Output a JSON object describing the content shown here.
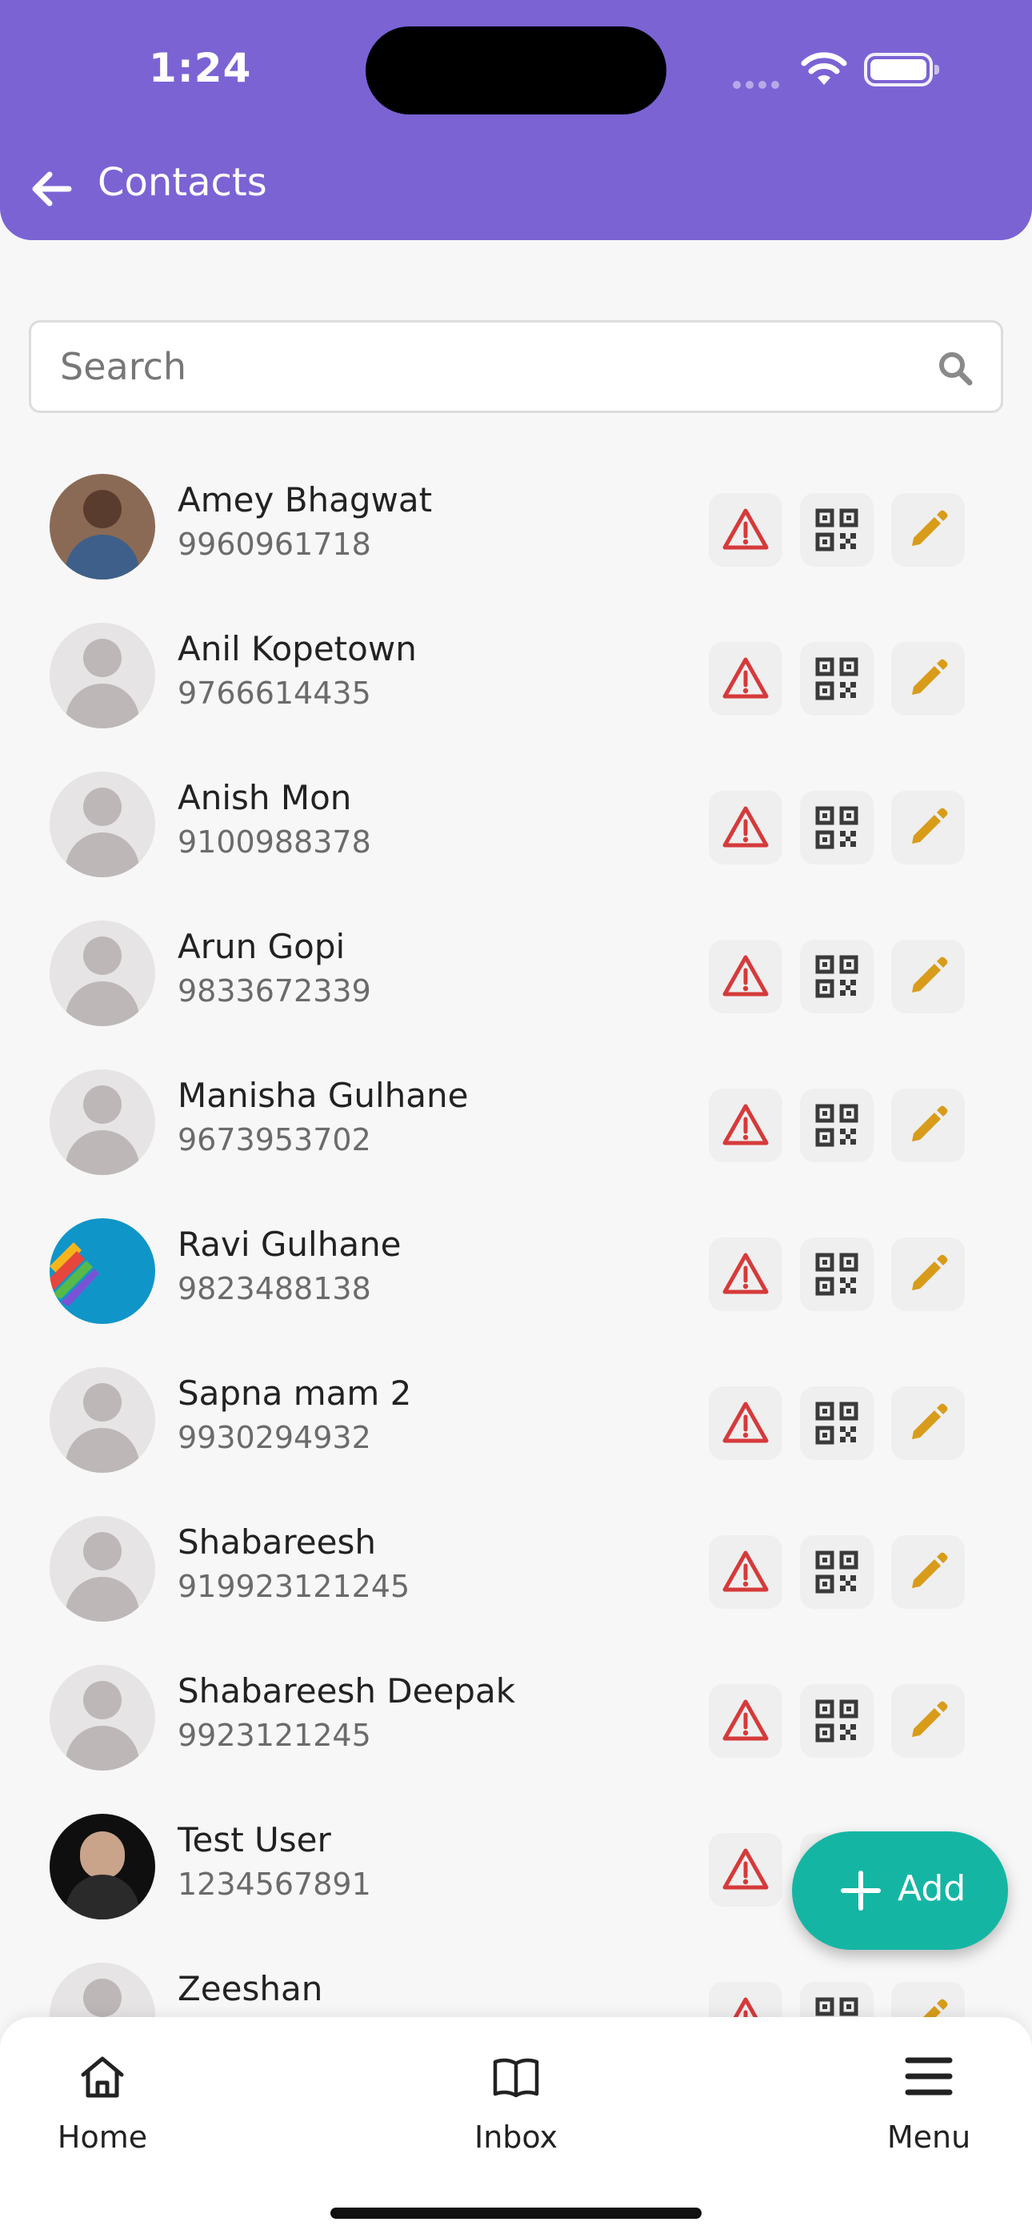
{
  "status_bar": {
    "time": "1:24"
  },
  "header": {
    "title": "Contacts"
  },
  "search": {
    "placeholder": "Search",
    "value": ""
  },
  "contacts": [
    {
      "name": "Amey Bhagwat",
      "phone": "9960961718"
    },
    {
      "name": "Anil Kopetown",
      "phone": "9766614435"
    },
    {
      "name": "Anish Mon",
      "phone": "9100988378"
    },
    {
      "name": "Arun Gopi",
      "phone": "9833672339"
    },
    {
      "name": "Manisha Gulhane",
      "phone": "9673953702"
    },
    {
      "name": "Ravi Gulhane",
      "phone": "9823488138"
    },
    {
      "name": "Sapna mam 2",
      "phone": "9930294932"
    },
    {
      "name": "Shabareesh",
      "phone": "919923121245"
    },
    {
      "name": "Shabareesh Deepak",
      "phone": "9923121245"
    },
    {
      "name": "Test User",
      "phone": "1234567891"
    },
    {
      "name": "Zeeshan",
      "phone": ""
    }
  ],
  "fab": {
    "label": "Add"
  },
  "bottom_nav": [
    {
      "label": "Home",
      "icon": "home-icon"
    },
    {
      "label": "Inbox",
      "icon": "book-icon"
    },
    {
      "label": "Menu",
      "icon": "menu-icon"
    }
  ],
  "colors": {
    "header": "#7b63d4",
    "fab": "#15b5a4",
    "warning": "#d63a3a",
    "edit": "#d89c1a"
  }
}
